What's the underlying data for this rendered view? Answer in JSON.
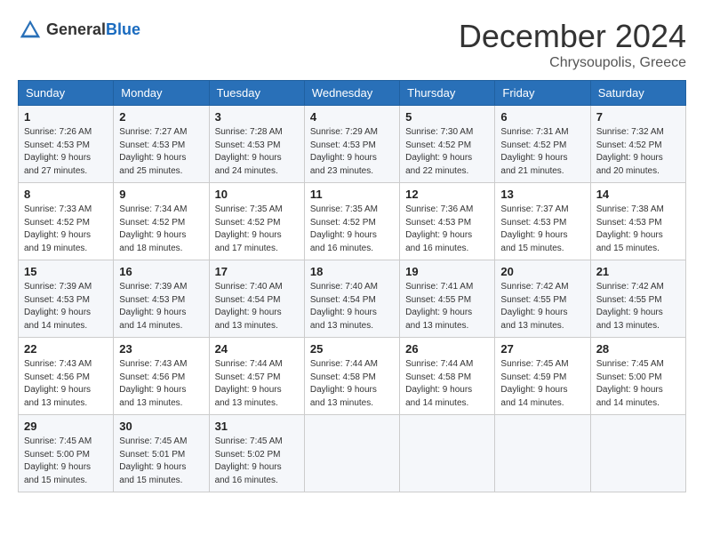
{
  "logo": {
    "text_general": "General",
    "text_blue": "Blue"
  },
  "title": "December 2024",
  "location": "Chrysoupolis, Greece",
  "days_of_week": [
    "Sunday",
    "Monday",
    "Tuesday",
    "Wednesday",
    "Thursday",
    "Friday",
    "Saturday"
  ],
  "weeks": [
    [
      {
        "day": "1",
        "sunrise": "7:26 AM",
        "sunset": "4:53 PM",
        "daylight": "9 hours and 27 minutes."
      },
      {
        "day": "2",
        "sunrise": "7:27 AM",
        "sunset": "4:53 PM",
        "daylight": "9 hours and 25 minutes."
      },
      {
        "day": "3",
        "sunrise": "7:28 AM",
        "sunset": "4:53 PM",
        "daylight": "9 hours and 24 minutes."
      },
      {
        "day": "4",
        "sunrise": "7:29 AM",
        "sunset": "4:53 PM",
        "daylight": "9 hours and 23 minutes."
      },
      {
        "day": "5",
        "sunrise": "7:30 AM",
        "sunset": "4:52 PM",
        "daylight": "9 hours and 22 minutes."
      },
      {
        "day": "6",
        "sunrise": "7:31 AM",
        "sunset": "4:52 PM",
        "daylight": "9 hours and 21 minutes."
      },
      {
        "day": "7",
        "sunrise": "7:32 AM",
        "sunset": "4:52 PM",
        "daylight": "9 hours and 20 minutes."
      }
    ],
    [
      {
        "day": "8",
        "sunrise": "7:33 AM",
        "sunset": "4:52 PM",
        "daylight": "9 hours and 19 minutes."
      },
      {
        "day": "9",
        "sunrise": "7:34 AM",
        "sunset": "4:52 PM",
        "daylight": "9 hours and 18 minutes."
      },
      {
        "day": "10",
        "sunrise": "7:35 AM",
        "sunset": "4:52 PM",
        "daylight": "9 hours and 17 minutes."
      },
      {
        "day": "11",
        "sunrise": "7:35 AM",
        "sunset": "4:52 PM",
        "daylight": "9 hours and 16 minutes."
      },
      {
        "day": "12",
        "sunrise": "7:36 AM",
        "sunset": "4:53 PM",
        "daylight": "9 hours and 16 minutes."
      },
      {
        "day": "13",
        "sunrise": "7:37 AM",
        "sunset": "4:53 PM",
        "daylight": "9 hours and 15 minutes."
      },
      {
        "day": "14",
        "sunrise": "7:38 AM",
        "sunset": "4:53 PM",
        "daylight": "9 hours and 15 minutes."
      }
    ],
    [
      {
        "day": "15",
        "sunrise": "7:39 AM",
        "sunset": "4:53 PM",
        "daylight": "9 hours and 14 minutes."
      },
      {
        "day": "16",
        "sunrise": "7:39 AM",
        "sunset": "4:53 PM",
        "daylight": "9 hours and 14 minutes."
      },
      {
        "day": "17",
        "sunrise": "7:40 AM",
        "sunset": "4:54 PM",
        "daylight": "9 hours and 13 minutes."
      },
      {
        "day": "18",
        "sunrise": "7:40 AM",
        "sunset": "4:54 PM",
        "daylight": "9 hours and 13 minutes."
      },
      {
        "day": "19",
        "sunrise": "7:41 AM",
        "sunset": "4:55 PM",
        "daylight": "9 hours and 13 minutes."
      },
      {
        "day": "20",
        "sunrise": "7:42 AM",
        "sunset": "4:55 PM",
        "daylight": "9 hours and 13 minutes."
      },
      {
        "day": "21",
        "sunrise": "7:42 AM",
        "sunset": "4:55 PM",
        "daylight": "9 hours and 13 minutes."
      }
    ],
    [
      {
        "day": "22",
        "sunrise": "7:43 AM",
        "sunset": "4:56 PM",
        "daylight": "9 hours and 13 minutes."
      },
      {
        "day": "23",
        "sunrise": "7:43 AM",
        "sunset": "4:56 PM",
        "daylight": "9 hours and 13 minutes."
      },
      {
        "day": "24",
        "sunrise": "7:44 AM",
        "sunset": "4:57 PM",
        "daylight": "9 hours and 13 minutes."
      },
      {
        "day": "25",
        "sunrise": "7:44 AM",
        "sunset": "4:58 PM",
        "daylight": "9 hours and 13 minutes."
      },
      {
        "day": "26",
        "sunrise": "7:44 AM",
        "sunset": "4:58 PM",
        "daylight": "9 hours and 14 minutes."
      },
      {
        "day": "27",
        "sunrise": "7:45 AM",
        "sunset": "4:59 PM",
        "daylight": "9 hours and 14 minutes."
      },
      {
        "day": "28",
        "sunrise": "7:45 AM",
        "sunset": "5:00 PM",
        "daylight": "9 hours and 14 minutes."
      }
    ],
    [
      {
        "day": "29",
        "sunrise": "7:45 AM",
        "sunset": "5:00 PM",
        "daylight": "9 hours and 15 minutes."
      },
      {
        "day": "30",
        "sunrise": "7:45 AM",
        "sunset": "5:01 PM",
        "daylight": "9 hours and 15 minutes."
      },
      {
        "day": "31",
        "sunrise": "7:45 AM",
        "sunset": "5:02 PM",
        "daylight": "9 hours and 16 minutes."
      },
      null,
      null,
      null,
      null
    ]
  ],
  "labels": {
    "sunrise": "Sunrise:",
    "sunset": "Sunset:",
    "daylight": "Daylight:"
  }
}
